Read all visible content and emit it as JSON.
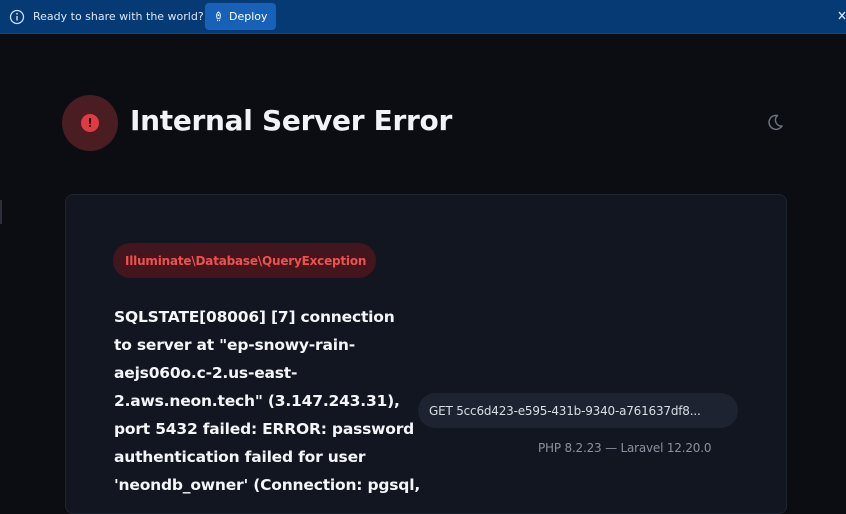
{
  "banner": {
    "message": "Ready to share with the world?",
    "deploy_label": "Deploy",
    "info_icon": "info-icon",
    "deploy_icon": "rocket-icon",
    "close_icon": "close-icon"
  },
  "error": {
    "title": "Internal Server Error",
    "icon": "exclamation-icon",
    "exception_class": "Illuminate\\Database\\QueryException",
    "message_lines": [
      "SQLSTATE[08006] [7] connection",
      "to server at \"ep-snowy-rain-",
      "aejs060o.c-2.us-east-",
      "2.aws.neon.tech\" (3.147.243.31),",
      "port 5432 failed: ERROR: password",
      "authentication failed for user",
      "'neondb_owner' (Connection: pgsql,"
    ],
    "request": "GET 5cc6d423-e595-431b-9340-a761637df8...",
    "versions": "PHP 8.2.23 — Laravel 12.20.0"
  },
  "theme_toggle_icon": "moon-icon",
  "colors": {
    "banner_bg": "#063a74",
    "deploy_bg": "#1761b8",
    "page_bg": "#0b0d12",
    "card_bg": "#121620",
    "error_red": "#e03b44",
    "exception_text": "#ef5050"
  }
}
